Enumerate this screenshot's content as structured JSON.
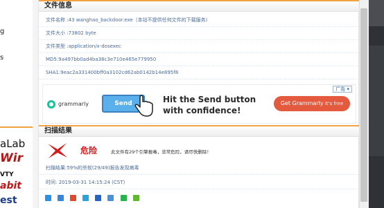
{
  "left_sidebar": {
    "text_fragments": [
      "g",
      "s"
    ],
    "logos": [
      {
        "name": "antilab",
        "text": "aLab",
        "color": "#111111"
      },
      {
        "name": "drweb",
        "text": "Wir",
        "color": "#b01818"
      },
      {
        "name": "vba",
        "text": "VTY",
        "color": "#111111"
      },
      {
        "name": "rabbit",
        "text": "abit",
        "color": "#c01818"
      },
      {
        "name": "est",
        "text": "est",
        "color": "#1a3c8a"
      }
    ]
  },
  "file_info": {
    "title": "文件信息",
    "rows": [
      "文件名称 :43 wanghao_backdoor.exe（本站不提供任何文件的下载服务）",
      "文件大小 :73802 byte",
      "文件类型 :application/x-dosexec",
      "MD5:9a497bb0ad4ba38c3e710e465e779950",
      "SHA1:9eac2a331400bff0a3102cd62ab0142b14e895f8"
    ]
  },
  "ad": {
    "tag": "广告 ▾",
    "brand": "grammarly",
    "button_label": "Send",
    "headline": "Hit the Send button with confidence!",
    "cta_main": "Get Grammarly",
    "cta_sub": " It's free",
    "colors": {
      "brand_green": "#15c39a",
      "button_blue": "#5ab0ea",
      "cta_red": "#e35a3e"
    }
  },
  "scan_result": {
    "title": "扫描结果",
    "status_label": "危险",
    "description": "此文件有29个引擎报毒，非常危险，请尽快删除！",
    "summary": "扫描结果:59%的杀软(29/49)报告发现病毒",
    "time": "时间: 2019-03-31 14:15:24 (CST)",
    "status_color": "#d41c1c"
  },
  "share_icons": [
    "qzone-icon",
    "weibo-icon",
    "renren-icon",
    "pengyou-icon",
    "baidu-icon",
    "kaixin-icon",
    "douban-icon",
    "wechat-icon"
  ]
}
